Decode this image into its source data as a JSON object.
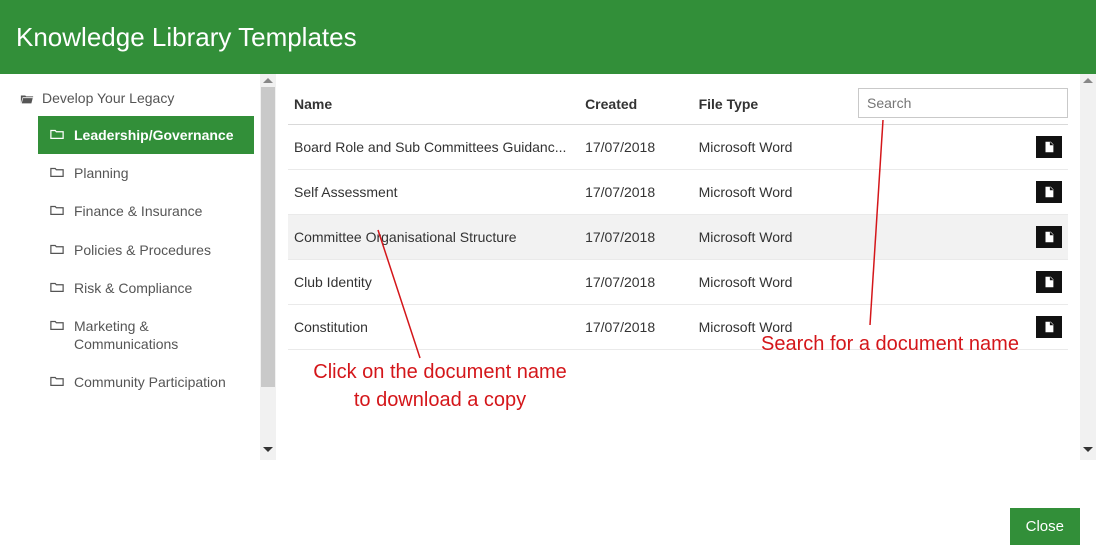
{
  "header": {
    "title": "Knowledge Library Templates"
  },
  "sidebar": {
    "root": "Develop Your Legacy",
    "items": [
      {
        "label": "Leadership/Governance"
      },
      {
        "label": "Planning"
      },
      {
        "label": "Finance & Insurance"
      },
      {
        "label": "Policies & Procedures"
      },
      {
        "label": "Risk & Compliance"
      },
      {
        "label": "Marketing & Communications"
      },
      {
        "label": "Community Participation"
      }
    ]
  },
  "table": {
    "headers": {
      "name": "Name",
      "created": "Created",
      "filetype": "File Type"
    },
    "search_placeholder": "Search",
    "rows": [
      {
        "name": "Board Role and Sub Committees Guidanc...",
        "created": "17/07/2018",
        "filetype": "Microsoft Word"
      },
      {
        "name": "Self Assessment",
        "created": "17/07/2018",
        "filetype": "Microsoft Word"
      },
      {
        "name": "Committee Organisational Structure",
        "created": "17/07/2018",
        "filetype": "Microsoft Word"
      },
      {
        "name": "Club Identity",
        "created": "17/07/2018",
        "filetype": "Microsoft Word"
      },
      {
        "name": "Constitution",
        "created": "17/07/2018",
        "filetype": "Microsoft Word"
      }
    ]
  },
  "footer": {
    "close_label": "Close"
  },
  "annotations": {
    "left": "Click on the document name\nto download a copy",
    "right": "Search for a document name"
  }
}
